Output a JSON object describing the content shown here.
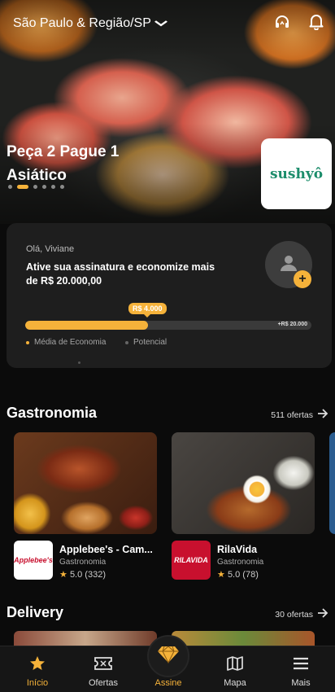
{
  "header": {
    "location": "São Paulo & Região/SP"
  },
  "promo": {
    "line1": "Peça 2 Pague 1",
    "line2": "Asiático",
    "brand": "sushyô"
  },
  "savings": {
    "greeting": "Olá, Viviane",
    "message": "Ative sua assinatura e economize mais de  R$ 20.000,00",
    "current_value": "R$ 4.000",
    "potential_value": "+R$ 20.000",
    "progress": 0.43,
    "legend_avg": "Média de Economia",
    "legend_potential": "Potencial"
  },
  "gastronomia": {
    "title": "Gastronomia",
    "count": "511 ofertas",
    "items": [
      {
        "name": "Applebee's - Cam...",
        "category": "Gastronomia",
        "rating": "5.0",
        "reviews": "(332)",
        "logo_text": "Applebee's"
      },
      {
        "name": "RilaVida",
        "category": "Gastronomia",
        "rating": "5.0",
        "reviews": "(78)",
        "logo_text": "RILAVIDA"
      }
    ]
  },
  "delivery": {
    "title": "Delivery",
    "count": "30 ofertas"
  },
  "nav": {
    "inicio": "Início",
    "ofertas": "Ofertas",
    "assine": "Assine",
    "mapa": "Mapa",
    "mais": "Mais"
  },
  "colors": {
    "accent": "#f5b23a",
    "card": "#1e1e1e",
    "background": "#0b0b0b"
  },
  "icons": [
    "chevron-down-icon",
    "support-headset-icon",
    "bell-icon",
    "user-icon",
    "plus-icon",
    "arrow-right-icon",
    "star-icon",
    "ticket-icon",
    "diamond-icon",
    "map-icon",
    "menu-icon"
  ]
}
